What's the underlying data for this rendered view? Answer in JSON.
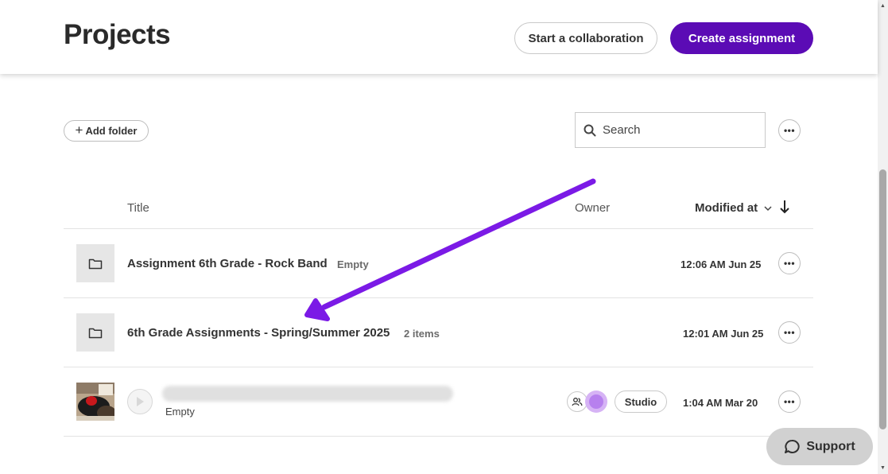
{
  "header": {
    "title": "Projects",
    "collab_label": "Start a collaboration",
    "create_label": "Create assignment"
  },
  "toolbar": {
    "add_folder_label": "Add folder",
    "search_placeholder": "Search"
  },
  "table": {
    "columns": {
      "title": "Title",
      "owner": "Owner",
      "modified": "Modified at"
    },
    "rows": [
      {
        "title": "Assignment 6th Grade - Rock Band",
        "meta": "Empty",
        "modified": "12:06 AM Jun 25"
      },
      {
        "title": "6th Grade Assignments - Spring/Summer 2025",
        "meta": "2 items",
        "modified": "12:01 AM Jun 25"
      },
      {
        "meta": "Empty",
        "badge": "Studio",
        "modified": "1:04 AM Mar 20"
      }
    ]
  },
  "support": {
    "label": "Support"
  },
  "colors": {
    "accent": "#5b0bb5",
    "annotation_arrow": "#7b1ae6",
    "avatar": "#d6b3f5"
  }
}
